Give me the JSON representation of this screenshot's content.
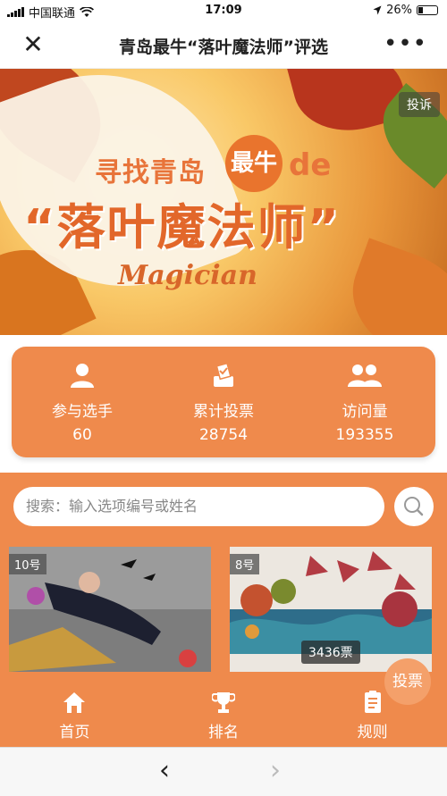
{
  "status_bar": {
    "carrier": "中国联通",
    "time": "17:09",
    "battery": "26%"
  },
  "titlebar": {
    "close": "✕",
    "title": "青岛最牛“落叶魔法师”评选",
    "more": "•••"
  },
  "banner": {
    "complain_label": "投诉",
    "line1": "寻找青岛",
    "badge": "最牛",
    "de": "de",
    "line2": "“落叶魔法师”",
    "magician": "Magician"
  },
  "stats": [
    {
      "label": "参与选手",
      "value": "60",
      "icon": "person-icon"
    },
    {
      "label": "累计投票",
      "value": "28754",
      "icon": "ballot-icon"
    },
    {
      "label": "访问量",
      "value": "193355",
      "icon": "group-icon"
    }
  ],
  "search": {
    "placeholder": "搜索：输入选项编号或姓名"
  },
  "entries": [
    {
      "number": "10号"
    },
    {
      "number": "8号",
      "votes": "3436票"
    }
  ],
  "vote_button": "投票",
  "tabs": [
    {
      "label": "首页",
      "icon": "home-icon"
    },
    {
      "label": "排名",
      "icon": "trophy-icon"
    },
    {
      "label": "规则",
      "icon": "rules-icon"
    }
  ],
  "bottom_nav": {
    "back": "‹",
    "forward": "›"
  },
  "colors": {
    "accent": "#ef8a4c",
    "banner_text": "#e2672a"
  }
}
